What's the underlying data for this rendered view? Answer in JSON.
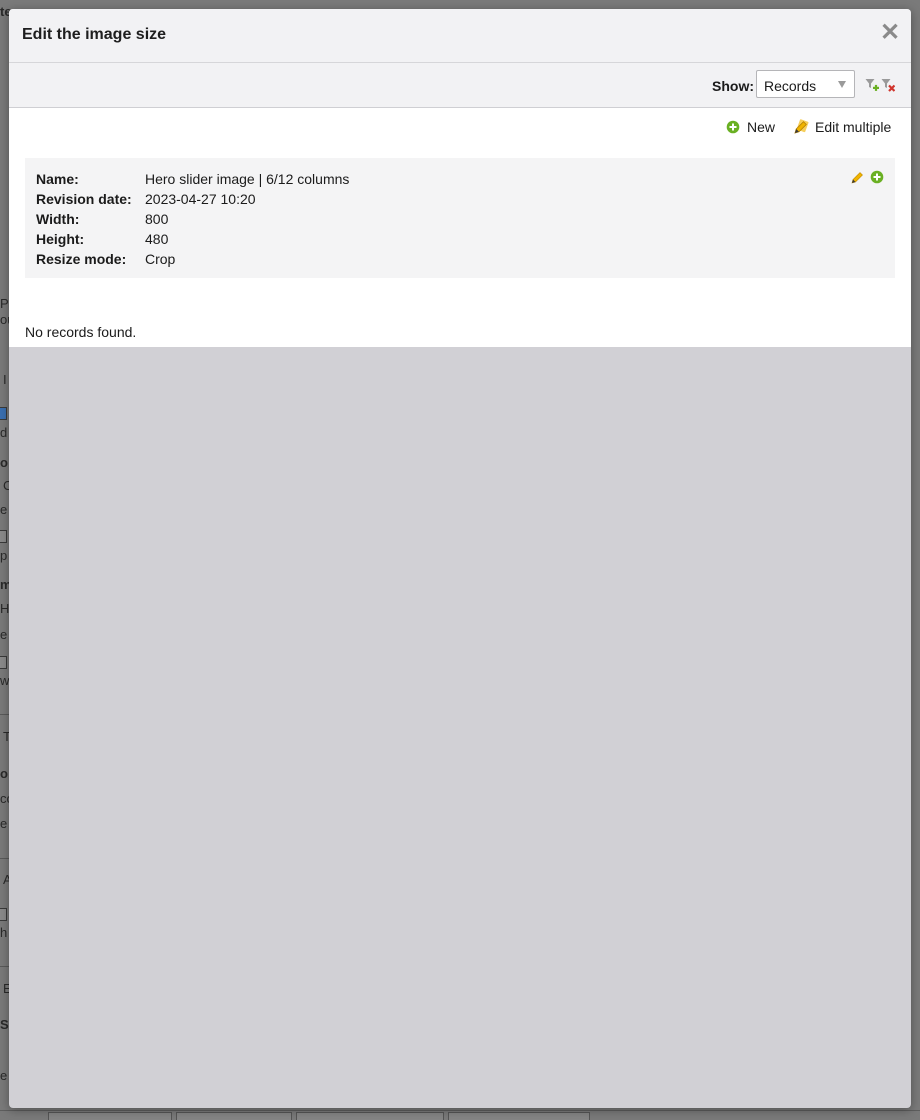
{
  "modal": {
    "title": "Edit the image size",
    "close_glyph": "✕"
  },
  "toolbar": {
    "show_label": "Show:",
    "show_select_value": "Records",
    "filter_add_icon": "filter-add-icon",
    "filter_remove_icon": "filter-remove-icon"
  },
  "actions": {
    "new_label": "New",
    "edit_multiple_label": "Edit multiple"
  },
  "record": {
    "fields": [
      {
        "label": "Name:",
        "value": "Hero slider image | 6/12 columns"
      },
      {
        "label": "Revision date:",
        "value": "2023-04-27 10:20"
      },
      {
        "label": "Width:",
        "value": "800"
      },
      {
        "label": "Height:",
        "value": "480"
      },
      {
        "label": "Resize mode:",
        "value": "Crop"
      }
    ]
  },
  "empty_message": "No records found.",
  "background_fragments": [
    "te",
    "P",
    "ou",
    "I",
    "d",
    "o",
    "C",
    "e",
    "p",
    "m",
    "H",
    "e",
    "w",
    "T",
    "o",
    "co",
    "e",
    "A",
    "h",
    "E",
    "S",
    "e"
  ],
  "colors": {
    "accent_green": "#6ab023",
    "pencil_yellow": "#f0b400",
    "remove_red": "#d0342c",
    "overlay_gray": "#d1d0d5",
    "header_bg": "#f2f2f4"
  }
}
